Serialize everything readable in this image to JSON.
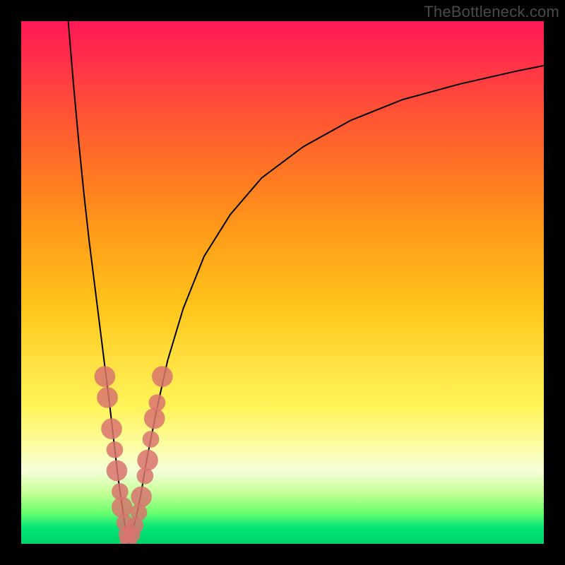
{
  "watermark": {
    "text": "TheBottleneck.com"
  },
  "chart_data": {
    "type": "line",
    "title": "",
    "xlabel": "",
    "ylabel": "",
    "xlim": [
      0,
      100
    ],
    "ylim": [
      0,
      100
    ],
    "grid": false,
    "legend": false,
    "background": "rainbow-gradient red-top green-bottom",
    "series": [
      {
        "name": "left-branch",
        "x": [
          9,
          10,
          11,
          12,
          13,
          14,
          15,
          16,
          17,
          17.8,
          18.5,
          19.2,
          19.8,
          20.2,
          20.5
        ],
        "y": [
          100,
          88,
          77,
          67,
          58,
          50,
          42,
          34,
          26,
          19,
          13,
          8,
          4,
          1.5,
          0
        ]
      },
      {
        "name": "right-branch",
        "x": [
          20.5,
          21,
          22,
          23,
          24,
          26,
          28,
          31,
          35,
          40,
          46,
          54,
          63,
          73,
          84,
          95,
          100
        ],
        "y": [
          0,
          1.5,
          5,
          10,
          16,
          26,
          35,
          45,
          55,
          63,
          70,
          76,
          81,
          85,
          88,
          90.5,
          91.5
        ]
      }
    ],
    "markers": [
      {
        "name": "dot",
        "x": 16.0,
        "y": 32,
        "r": 2.0
      },
      {
        "name": "dot",
        "x": 16.5,
        "y": 28,
        "r": 2.0
      },
      {
        "name": "dot",
        "x": 17.3,
        "y": 22,
        "r": 2.0
      },
      {
        "name": "dot",
        "x": 17.9,
        "y": 18,
        "r": 1.6
      },
      {
        "name": "dot",
        "x": 18.3,
        "y": 14,
        "r": 2.0
      },
      {
        "name": "dot",
        "x": 18.9,
        "y": 10,
        "r": 1.6
      },
      {
        "name": "dot",
        "x": 19.3,
        "y": 7,
        "r": 2.0
      },
      {
        "name": "dot",
        "x": 19.8,
        "y": 4,
        "r": 1.6
      },
      {
        "name": "dot",
        "x": 20.2,
        "y": 1.8,
        "r": 1.6
      },
      {
        "name": "dot",
        "x": 20.5,
        "y": 0.5,
        "r": 1.6
      },
      {
        "name": "dot",
        "x": 21.2,
        "y": 1.8,
        "r": 1.6
      },
      {
        "name": "dot",
        "x": 21.8,
        "y": 3.5,
        "r": 1.6
      },
      {
        "name": "dot",
        "x": 22.5,
        "y": 6,
        "r": 1.6
      },
      {
        "name": "dot",
        "x": 23.0,
        "y": 9,
        "r": 2.0
      },
      {
        "name": "dot",
        "x": 23.7,
        "y": 13,
        "r": 1.6
      },
      {
        "name": "dot",
        "x": 24.2,
        "y": 16,
        "r": 2.0
      },
      {
        "name": "dot",
        "x": 24.8,
        "y": 20,
        "r": 1.6
      },
      {
        "name": "dot",
        "x": 25.5,
        "y": 24,
        "r": 2.0
      },
      {
        "name": "dot",
        "x": 26.0,
        "y": 27,
        "r": 1.6
      },
      {
        "name": "dot",
        "x": 27.0,
        "y": 32,
        "r": 2.0
      }
    ],
    "marker_color": "#d9736f"
  }
}
